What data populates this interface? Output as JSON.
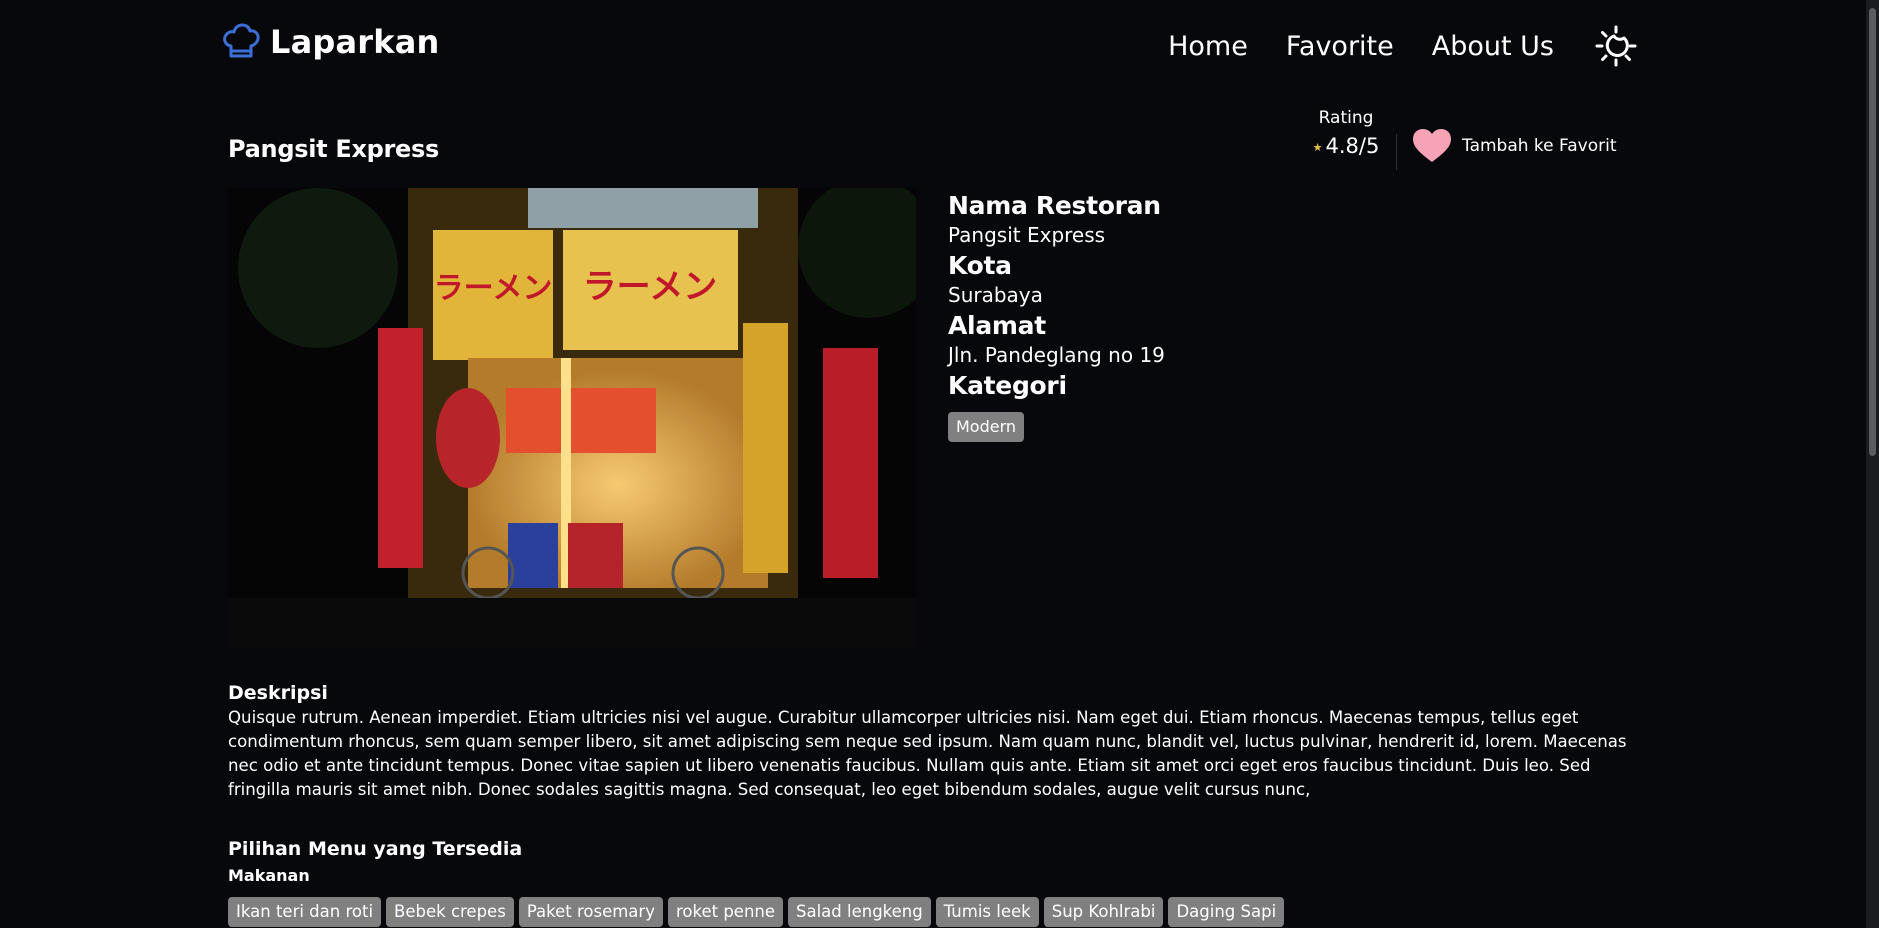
{
  "brand": {
    "name": "Laparkan",
    "icon": "chef-hat-icon",
    "icon_color": "#3b6fd6"
  },
  "nav": {
    "links": [
      "Home",
      "Favorite",
      "About Us"
    ],
    "theme_toggle_icon": "sun-moon-icon"
  },
  "restaurant": {
    "title": "Pangsit Express",
    "rating_label": "Rating",
    "rating_value": "4.8/5",
    "favorite_label": "Tambah ke Favorit",
    "favorite_icon": "heart-icon",
    "favorite_icon_color": "#f5a3b5",
    "image": "ramen-shop-night-photo",
    "details": [
      {
        "label": "Nama Restoran",
        "value": "Pangsit Express"
      },
      {
        "label": "Kota",
        "value": "Surabaya"
      },
      {
        "label": "Alamat",
        "value": "Jln. Pandeglang no 19"
      }
    ],
    "category_label": "Kategori",
    "categories": [
      "Modern"
    ]
  },
  "description": {
    "title": "Deskripsi",
    "text": "Quisque rutrum. Aenean imperdiet. Etiam ultricies nisi vel augue. Curabitur ullamcorper ultricies nisi. Nam eget dui. Etiam rhoncus. Maecenas tempus, tellus eget condimentum rhoncus, sem quam semper libero, sit amet adipiscing sem neque sed ipsum. Nam quam nunc, blandit vel, luctus pulvinar, hendrerit id, lorem. Maecenas nec odio et ante tincidunt tempus. Donec vitae sapien ut libero venenatis faucibus. Nullam quis ante. Etiam sit amet orci eget eros faucibus tincidunt. Duis leo. Sed fringilla mauris sit amet nibh. Donec sodales sagittis magna. Sed consequat, leo eget bibendum sodales, augue velit cursus nunc,"
  },
  "menu": {
    "title": "Pilihan Menu yang Tersedia",
    "food_label": "Makanan",
    "foods": [
      "Ikan teri dan roti",
      "Bebek crepes",
      "Paket rosemary",
      "roket penne",
      "Salad lengkeng",
      "Tumis leek",
      "Sup Kohlrabi",
      "Daging Sapi"
    ]
  },
  "colors": {
    "background": "#07080c",
    "chip": "#808080",
    "text": "#ffffff"
  }
}
